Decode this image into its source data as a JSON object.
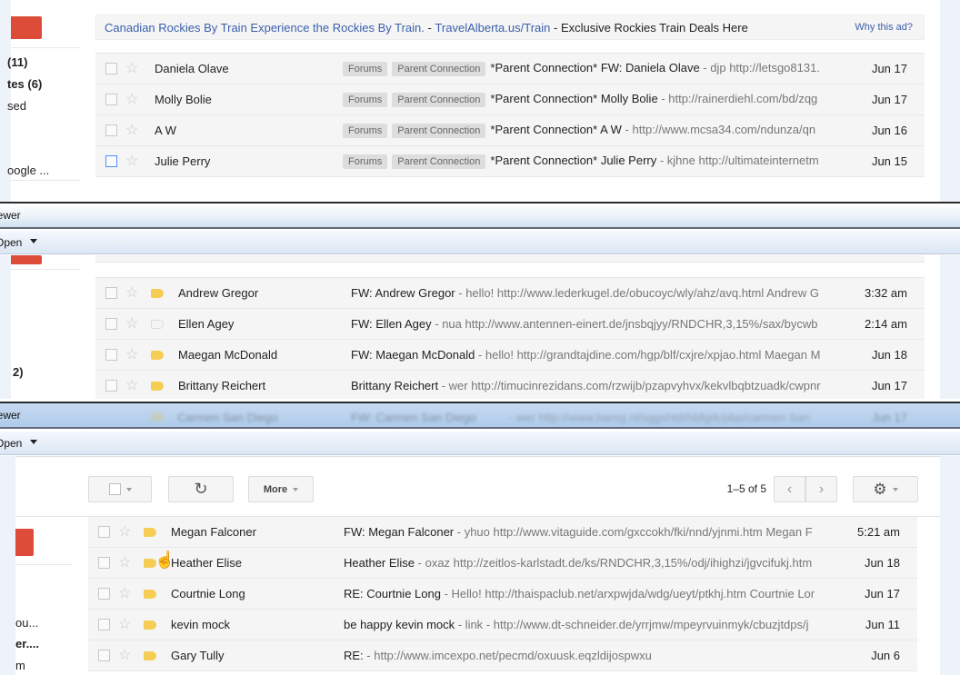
{
  "panel1": {
    "sidebar": [
      {
        "text": "(11)",
        "bold": true
      },
      {
        "text": "tes (6)",
        "bold": true
      },
      {
        "text": "sed",
        "bold": false
      },
      {
        "text": "oogle ...",
        "bold": false
      }
    ],
    "ad": {
      "title": "Canadian Rockies By Train Experience the Rockies By Train.",
      "sep1": " - ",
      "url": "TravelAlberta.us/Train",
      "sep2": " - ",
      "text": "Exclusive Rockies Train Deals Here",
      "why": "Why this ad?"
    },
    "rows": [
      {
        "sender": "Daniela Olave",
        "labels": [
          "Forums",
          "Parent Connection"
        ],
        "subject": "*Parent Connection* FW: Daniela Olave",
        "snippet": " - djp http://letsgo8131.",
        "date": "Jun 17",
        "focus": false
      },
      {
        "sender": "Molly Bolie",
        "labels": [
          "Forums",
          "Parent Connection"
        ],
        "subject": "*Parent Connection* Molly Bolie",
        "snippet": " - http://rainerdiehl.com/bd/zqg",
        "date": "Jun 17",
        "focus": false
      },
      {
        "sender": "A W",
        "labels": [
          "Forums",
          "Parent Connection"
        ],
        "subject": "*Parent Connection* A W",
        "snippet": " - http://www.mcsa34.com/ndunza/qn",
        "date": "Jun 16",
        "focus": false
      },
      {
        "sender": "Julie Perry",
        "labels": [
          "Forums",
          "Parent Connection"
        ],
        "subject": "*Parent Connection* Julie Perry",
        "snippet": " - kjhne http://ultimateinternetm",
        "date": "Jun 15",
        "focus": true
      }
    ]
  },
  "window2": {
    "title": "iewer",
    "toolbar_open": "Open",
    "sidebar": [
      {
        "text": "2)",
        "bold": true
      }
    ],
    "rows": [
      {
        "sender": "Andrew Gregor",
        "important": true,
        "subject": "FW: Andrew Gregor",
        "snippet": " - hello! http://www.lederkugel.de/obucoyc/wly/ahz/avq.html Andrew G",
        "date": "3:32 am"
      },
      {
        "sender": "Ellen Agey",
        "important": false,
        "subject": "FW: Ellen Agey",
        "snippet": " - nua http://www.antennen-einert.de/jnsbqjyy/RNDCHR,3,15%/sax/bycwb",
        "date": "2:14 am"
      },
      {
        "sender": "Maegan McDonald",
        "important": true,
        "subject": "FW: Maegan McDonald",
        "snippet": " - hello! http://grandtajdine.com/hgp/blf/cxjre/xpjao.html Maegan M",
        "date": "Jun 18"
      },
      {
        "sender": "Brittany Reichert",
        "important": true,
        "subject": "Brittany Reichert",
        "snippet": " - wer http://timucinrezidans.com/rzwijb/pzapvyhvx/kekvlbqbtzuadk/cwpnr",
        "date": "Jun 17"
      }
    ],
    "ghost_row": {
      "sender": "Carmen San Diego",
      "subject": "FW: Carmen San Diego",
      "snippet": " - wer http://www.barsg.nl/sggvhtdrhbfgrk/pbp/carmen San",
      "date": "Jun 17"
    }
  },
  "window3": {
    "title": "iewer",
    "toolbar_open": "Open",
    "toolbar": {
      "more_label": "More",
      "pager": "1–5 of 5"
    },
    "sidebar": [
      {
        "text": "ou...",
        "bold": false
      },
      {
        "text": "er....",
        "bold": true
      },
      {
        "text": "m",
        "bold": false
      }
    ],
    "rows": [
      {
        "sender": "Megan Falconer",
        "important": true,
        "subject": "FW: Megan Falconer",
        "snippet": " - yhuo http://www.vitaguide.com/gxccokh/fki/nnd/yjnmi.htm Megan F",
        "date": "5:21 am"
      },
      {
        "sender": "Heather Elise",
        "important": true,
        "subject": "Heather Elise",
        "snippet": " - oxaz http://zeitlos-karlstadt.de/ks/RNDCHR,3,15%/odj/ihighzi/jgvcifukj.htm",
        "date": "Jun 18"
      },
      {
        "sender": "Courtnie Long",
        "important": true,
        "subject": "RE: Courtnie Long",
        "snippet": " - Hello! http://thaispaclub.net/arxpwjda/wdg/ueyt/ptkhj.htm Courtnie Lon",
        "date": "Jun 17"
      },
      {
        "sender": "kevin mock",
        "important": true,
        "subject": "be happy kevin mock",
        "snippet": " - link - http://www.dt-schneider.de/yrrjmw/mpeyrvuinmyk/cbuzjtdps/j",
        "date": "Jun 11"
      },
      {
        "sender": "Gary Tully",
        "important": true,
        "subject": "RE:",
        "snippet": " - http://www.imcexpo.net/pecmd/oxuusk.eqzldijospwxu",
        "date": "Jun 6"
      }
    ]
  },
  "colors": {
    "compose_red": "#dd4b39",
    "link_blue": "#3b5fac",
    "important_yellow": "#f6cd54"
  }
}
